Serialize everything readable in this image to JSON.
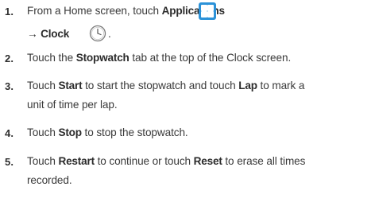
{
  "steps": [
    {
      "number": "1.",
      "line1_pre": "From a Home screen, touch ",
      "line1_bold": "Applications",
      "arrow": "→",
      "line2_bold": "Clock",
      "line2_end": "."
    },
    {
      "number": "2.",
      "pre": "Touch the ",
      "bold": "Stopwatch",
      "post": " tab at the top of the Clock screen."
    },
    {
      "number": "3.",
      "pre": "Touch ",
      "bold1": "Start",
      "mid": " to start the stopwatch and touch ",
      "bold2": "Lap",
      "post": " to mark a",
      "line2": "unit of time per lap."
    },
    {
      "number": "4.",
      "pre": "Touch ",
      "bold": "Stop",
      "post": " to stop the stopwatch."
    },
    {
      "number": "5.",
      "pre": "Touch ",
      "bold1": "Restart",
      "mid": " to continue or touch ",
      "bold2": "Reset",
      "post": " to erase all times",
      "line2": "recorded."
    }
  ],
  "icons": {
    "applications": "applications-grid-icon",
    "clock": "clock-icon",
    "applications_color": "#2c92d8",
    "clock_color": "#7a7a7a"
  }
}
